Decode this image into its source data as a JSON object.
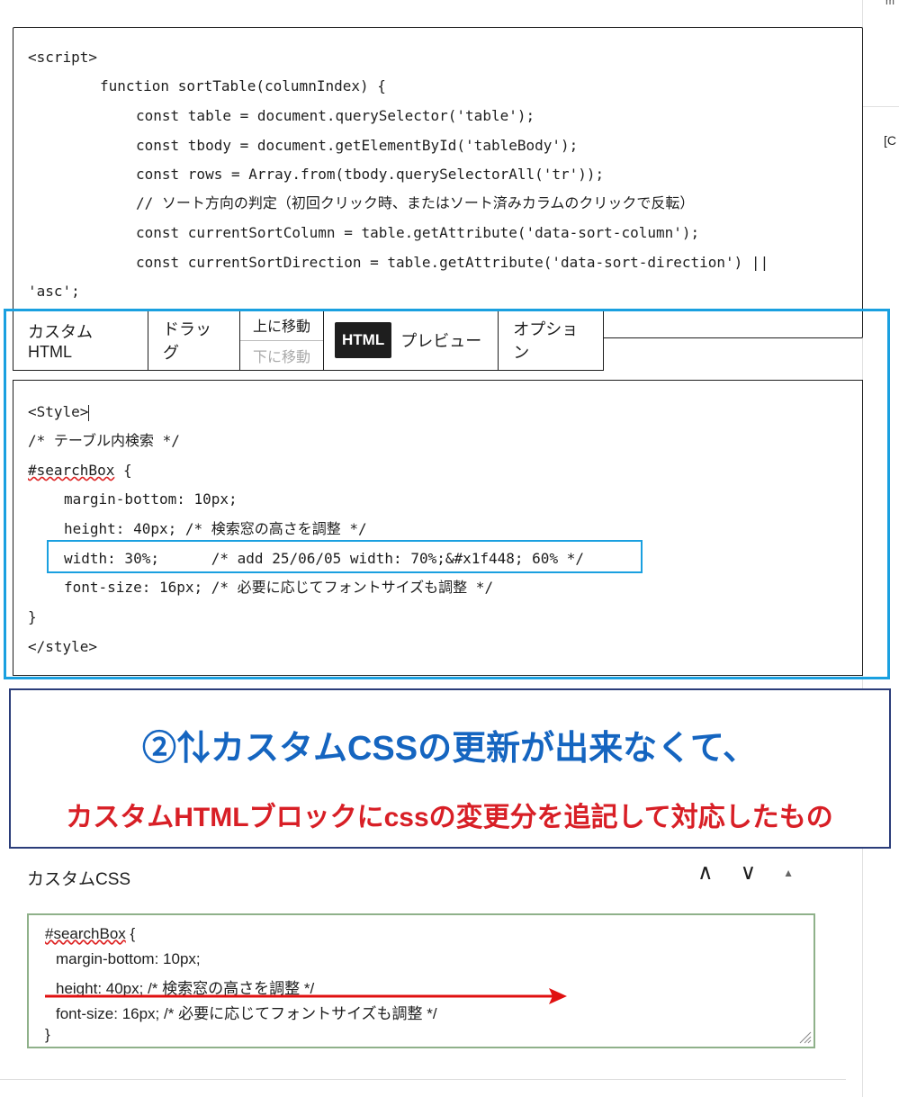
{
  "top_code": {
    "lines": [
      "<script>",
      "function sortTable(columnIndex) {",
      "const table = document.querySelector('table');",
      "const tbody = document.getElementById('tableBody');",
      "const rows = Array.from(tbody.querySelectorAll('tr'));",
      "// ソート方向の判定（初回クリック時、またはソート済みカラムのクリックで反転）",
      "const currentSortColumn = table.getAttribute('data-sort-column');",
      "const currentSortDirection = table.getAttribute('data-sort-direction') ||",
      "'asc';"
    ]
  },
  "toolbar": {
    "custom_html": "カスタム HTML",
    "drag": "ドラッグ",
    "move_up": "上に移動",
    "move_down": "下に移動",
    "html": "HTML",
    "preview": "プレビュー",
    "options": "オプション"
  },
  "editor": {
    "line1": "<Style>",
    "line2": "/* テーブル内検索 */",
    "line3_id": "#searchBox",
    "line3_rest": " {",
    "line4": "margin-bottom: 10px;",
    "line5": "height: 40px; /* 検索窓の高さを調整 */",
    "line6": "width: 30%;      /* add 25/06/05 width: 70%;&#x1f448; 60% */",
    "line7": "font-size: 16px; /* 必要に応じてフォントサイズも調整 */",
    "line8": "}",
    "line9": "</style>"
  },
  "annotation": {
    "line1": "②⇅カスタムCSSの更新が出来なくて、",
    "line2": "カスタムHTMLブロックにcssの変更分を追記して対応したもの"
  },
  "custom_css": {
    "title": "カスタムCSS",
    "line1_id": "#searchBox",
    "line1_rest": " {",
    "line2": "margin-bottom: 10px;",
    "line3": "height: 40px; /* 検索窓の高さを調整 */",
    "line4": "font-size: 16px; /* 必要に応じてフォントサイズも調整 */",
    "line5": "}"
  },
  "right_panel": {
    "fragment_top": "m",
    "fragment": "[C"
  },
  "colors": {
    "highlight_blue": "#1aa0e0",
    "annotation_blue": "#1565c0",
    "annotation_red": "#d81f26",
    "arrow_red": "#e01010",
    "css_editor_border": "#8fb18a"
  }
}
